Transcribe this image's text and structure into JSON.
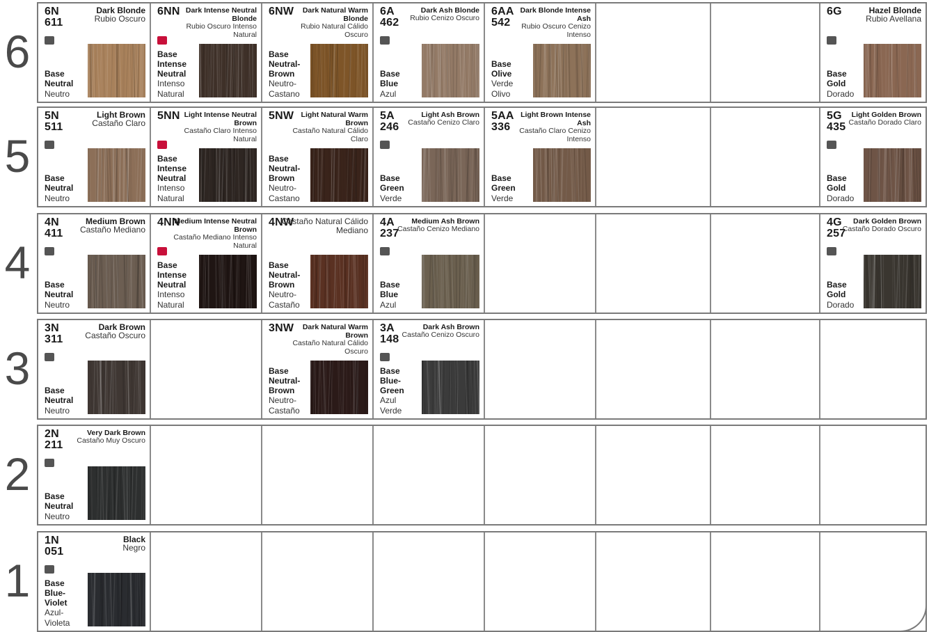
{
  "colors": {
    "grid_border": "#7a7a7a",
    "square_gray": "#555555",
    "square_red": "#c8103a"
  },
  "levels": [
    {
      "number": "6",
      "cells": [
        {
          "col": 0,
          "code": [
            "6N",
            "611"
          ],
          "en": "Dark Blonde",
          "es": "Rubio Oscuro",
          "base": [
            "Base",
            "Neutral"
          ],
          "base_es": [
            "Neutro"
          ],
          "sq": "gray",
          "swatch": "#a8815b"
        },
        {
          "col": 1,
          "code": [
            "6NN"
          ],
          "en": "Dark Intense Neutral Blonde",
          "es": "Rubio Oscuro Intenso Natural",
          "base": [
            "Base",
            "Intense",
            "Neutral"
          ],
          "base_es": [
            "Intenso",
            "Natural"
          ],
          "sq": "red",
          "swatch": "#3e3028"
        },
        {
          "col": 2,
          "code": [
            "6NW"
          ],
          "en": "Dark Natural Warm Blonde",
          "es": "Rubio Natural Cálido Oscuro",
          "base": [
            "Base",
            "Neutral-",
            "Brown"
          ],
          "base_es": [
            "Neutro-",
            "Castano"
          ],
          "sq": "",
          "swatch": "#7e5528"
        },
        {
          "col": 3,
          "code": [
            "6A",
            "462"
          ],
          "en": "Dark Ash Blonde",
          "es": "Rubio Cenizo Oscuro",
          "base": [
            "Base",
            "Blue"
          ],
          "base_es": [
            "Azul"
          ],
          "sq": "gray",
          "swatch": "#937a66"
        },
        {
          "col": 4,
          "code": [
            "6AA",
            "542"
          ],
          "en": "Dark Blonde Intense Ash",
          "es": "Rubio Oscuro Cenizo Intenso",
          "base": [
            "Base",
            "Olive"
          ],
          "base_es": [
            "Verde",
            "Olivo"
          ],
          "sq": "",
          "swatch": "#8d7259"
        },
        {
          "col": 7,
          "code": [
            "6G"
          ],
          "en": "Hazel Blonde",
          "es": "Rubio Avellana",
          "base": [
            "Base",
            "Gold"
          ],
          "base_es": [
            "Dorado"
          ],
          "sq": "gray",
          "swatch": "#8a6752"
        }
      ]
    },
    {
      "number": "5",
      "cells": [
        {
          "col": 0,
          "code": [
            "5N",
            "511"
          ],
          "en": "Light Brown",
          "es": "Castaño Claro",
          "base": [
            "Base",
            "Neutral"
          ],
          "base_es": [
            "Neutro"
          ],
          "sq": "gray",
          "swatch": "#8c6f58"
        },
        {
          "col": 1,
          "code": [
            "5NN"
          ],
          "en": "Light Intense Neutral Brown",
          "es": "Castaño Claro Intenso Natural",
          "base": [
            "Base",
            "Intense",
            "Neutral"
          ],
          "base_es": [
            "Intenso",
            "Natural"
          ],
          "sq": "red",
          "swatch": "#2e2622"
        },
        {
          "col": 2,
          "code": [
            "5NW"
          ],
          "en": "Light Natural Warm Brown",
          "es": "Castaño Natural Cálido Claro",
          "base": [
            "Base",
            "Neutral-",
            "Brown"
          ],
          "base_es": [
            "Neutro-",
            "Castano"
          ],
          "sq": "",
          "swatch": "#3a241b"
        },
        {
          "col": 3,
          "code": [
            "5A",
            "246"
          ],
          "en": "Light Ash Brown",
          "es": "Castaño Cenizo Claro",
          "base": [
            "Base",
            "Green"
          ],
          "base_es": [
            "Verde"
          ],
          "sq": "gray",
          "swatch": "#7a6658"
        },
        {
          "col": 4,
          "code": [
            "5AA",
            "336"
          ],
          "en": "Light Brown Intense Ash",
          "es": "Castaño Claro Cenizo Intenso",
          "base": [
            "Base",
            "Green"
          ],
          "base_es": [
            "Verde"
          ],
          "sq": "",
          "swatch": "#735a48"
        },
        {
          "col": 7,
          "code": [
            "5G",
            "435"
          ],
          "en": "Light Golden Brown",
          "es": "Castaño Dorado Claro",
          "base": [
            "Base",
            "Gold"
          ],
          "base_es": [
            "Dorado"
          ],
          "sq": "gray",
          "swatch": "#6e5446"
        }
      ]
    },
    {
      "number": "4",
      "cells": [
        {
          "col": 0,
          "code": [
            "4N",
            "411"
          ],
          "en": "Medium Brown",
          "es": "Castaño Mediano",
          "base": [
            "Base",
            "Neutral"
          ],
          "base_es": [
            "Neutro"
          ],
          "sq": "gray",
          "swatch": "#6c5e52"
        },
        {
          "col": 1,
          "code": [
            "4NN"
          ],
          "en": "Medium Intense Neutral Brown",
          "es": "Castaño Mediano Intenso Natural",
          "base": [
            "Base",
            "Intense",
            "Neutral"
          ],
          "base_es": [
            "Intenso",
            "Natural"
          ],
          "sq": "red",
          "swatch": "#1f1513"
        },
        {
          "col": 2,
          "code": [
            "4NW"
          ],
          "en": "",
          "es": "Castaño Natural Cálido Mediano",
          "base": [
            "Base",
            "Neutral-",
            "Brown"
          ],
          "base_es": [
            "Neutro-",
            "Castaño"
          ],
          "sq": "",
          "swatch": "#5a3122"
        },
        {
          "col": 3,
          "code": [
            "4A",
            "237"
          ],
          "en": "Medium Ash Brown",
          "es": "Castaño Cenizo Mediano",
          "base": [
            "Base",
            "Blue"
          ],
          "base_es": [
            "Azul"
          ],
          "sq": "gray",
          "swatch": "#6b604f"
        },
        {
          "col": 7,
          "code": [
            "4G",
            "257"
          ],
          "en": "Dark Golden Brown",
          "es": "Castaño Dorado Oscuro",
          "base": [
            "Base",
            "Gold"
          ],
          "base_es": [
            "Dorado"
          ],
          "sq": "gray",
          "swatch": "#3a3630"
        }
      ]
    },
    {
      "number": "3",
      "cells": [
        {
          "col": 0,
          "code": [
            "3N",
            "311"
          ],
          "en": "Dark Brown",
          "es": "Castaño Oscuro",
          "base": [
            "Base",
            "Neutral"
          ],
          "base_es": [
            "Neutro"
          ],
          "sq": "gray",
          "swatch": "#3f3733"
        },
        {
          "col": 2,
          "code": [
            "3NW"
          ],
          "en": "Dark Natural Warm Brown",
          "es": "Castaño Natural Cálido Oscuro",
          "base": [
            "Base",
            "Neutral-",
            "Brown"
          ],
          "base_es": [
            "Neutro-",
            "Castaño"
          ],
          "sq": "",
          "swatch": "#2b1a18"
        },
        {
          "col": 3,
          "code": [
            "3A",
            "148"
          ],
          "en": "Dark Ash Brown",
          "es": "Castaño Cenizo Oscuro",
          "base": [
            "Base",
            "Blue-",
            "Green"
          ],
          "base_es": [
            "Azul",
            "Verde"
          ],
          "sq": "gray",
          "swatch": "#3b3b3b"
        }
      ]
    },
    {
      "number": "2",
      "cells": [
        {
          "col": 0,
          "code": [
            "2N",
            "211"
          ],
          "en": "Very Dark Brown",
          "es": "Castaño Muy Oscuro",
          "base": [
            "Base",
            "Neutral"
          ],
          "base_es": [
            "Neutro"
          ],
          "sq": "gray",
          "swatch": "#2d2f2f"
        }
      ]
    },
    {
      "number": "1",
      "cells": [
        {
          "col": 0,
          "code": [
            "1N",
            "051"
          ],
          "en": "Black",
          "es": "Negro",
          "base": [
            "Base",
            "Blue-",
            "Violet"
          ],
          "base_es": [
            "Azul-",
            "Violeta"
          ],
          "sq": "gray",
          "swatch": "#2a2c30"
        }
      ]
    }
  ]
}
